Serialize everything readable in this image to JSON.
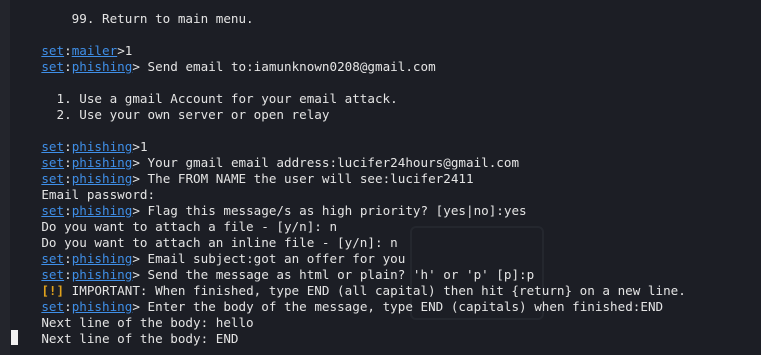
{
  "terminal": {
    "lines": [
      {
        "id": "l0",
        "text": "    99. Return to main menu."
      },
      {
        "id": "l1",
        "prompt": {
          "set": "set",
          "module": "mailer",
          "end": ">"
        },
        "text": "1"
      },
      {
        "id": "l2",
        "prompt": {
          "set": "set",
          "module": "phishing",
          "end": ">"
        },
        "text": " Send email to:iamunknown0208@gmail.com"
      },
      {
        "id": "l3",
        "text": "  1. Use a gmail Account for your email attack."
      },
      {
        "id": "l4",
        "text": "  2. Use your own server or open relay"
      },
      {
        "id": "l5",
        "prompt": {
          "set": "set",
          "module": "phishing",
          "end": ">"
        },
        "text": "1"
      },
      {
        "id": "l6",
        "prompt": {
          "set": "set",
          "module": "phishing",
          "end": ">"
        },
        "text": " Your gmail email address:lucifer24hours@gmail.com"
      },
      {
        "id": "l7",
        "prompt": {
          "set": "set",
          "module": "phishing",
          "end": ">"
        },
        "text": " The FROM NAME the user will see:lucifer2411"
      },
      {
        "id": "l8",
        "text": "Email password:"
      },
      {
        "id": "l9",
        "prompt": {
          "set": "set",
          "module": "phishing",
          "end": ">"
        },
        "text": " Flag this message/s as high priority? [yes|no]:yes"
      },
      {
        "id": "l10",
        "text": "Do you want to attach a file - [y/n]: n"
      },
      {
        "id": "l11",
        "text": "Do you want to attach an inline file - [y/n]: n"
      },
      {
        "id": "l12",
        "prompt": {
          "set": "set",
          "module": "phishing",
          "end": ">"
        },
        "text": " Email subject:got an offer for you"
      },
      {
        "id": "l13",
        "prompt": {
          "set": "set",
          "module": "phishing",
          "end": ">"
        },
        "text": " Send the message as html or plain? 'h' or 'p' [p]:p"
      },
      {
        "id": "l14",
        "warn": "[!]",
        "text": " IMPORTANT: When finished, type END (all capital) then hit {return} on a new line."
      },
      {
        "id": "l15",
        "prompt": {
          "set": "set",
          "module": "phishing",
          "end": ">"
        },
        "text": " Enter the body of the message, type END (capitals) when finished:END"
      },
      {
        "id": "l16",
        "text": "Next line of the body: hello"
      },
      {
        "id": "l17",
        "text": "Next line of the body: END"
      }
    ]
  },
  "colors": {
    "background": "#1c1e25",
    "prompt_blue": "#3f8fe8",
    "warning_yellow": "#e0a21c",
    "text": "#e4e4e4"
  }
}
